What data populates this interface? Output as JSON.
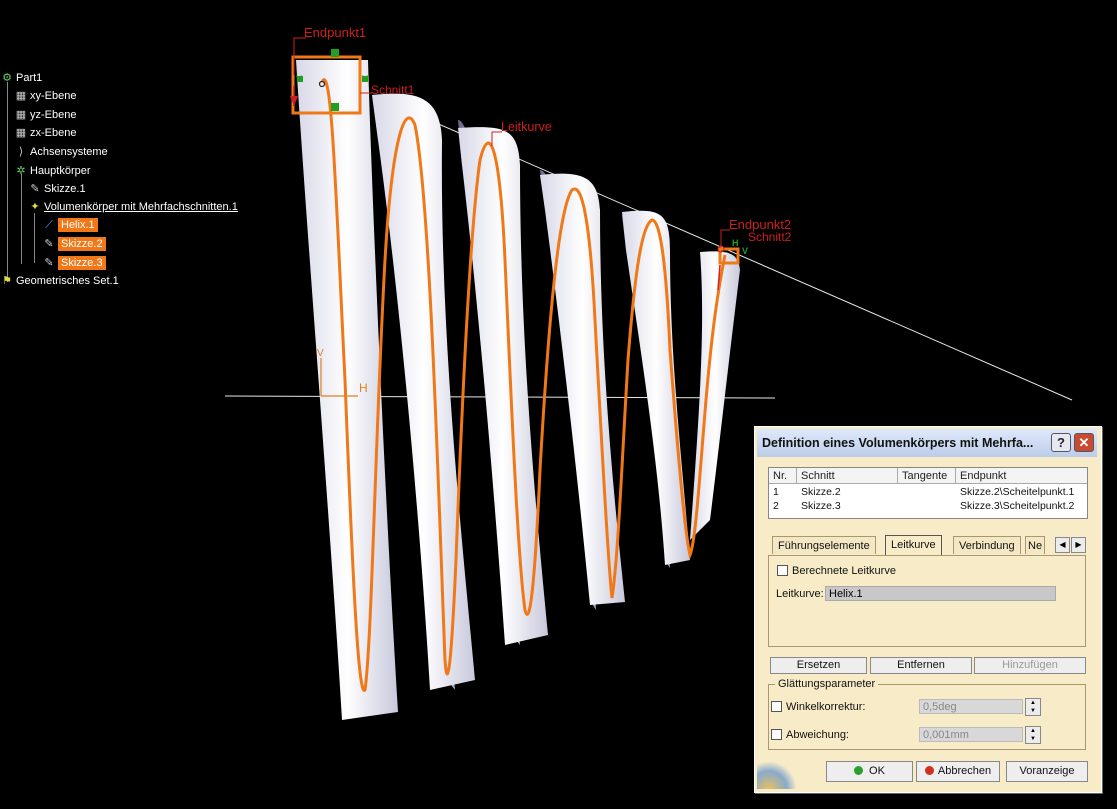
{
  "viewport": {
    "labels": {
      "endpoint1": "Endpunkt1",
      "section1": "Schnitt1",
      "guide_curve": "Leitkurve",
      "endpoint2": "Endpunkt2",
      "section2": "Schnitt2",
      "axis_h": "H",
      "axis_v": "V"
    },
    "colors": {
      "background": "#000000",
      "curve": "#f07818",
      "annotation": "#cc2020",
      "marker": "#20a020"
    }
  },
  "tree": {
    "items": [
      {
        "label": "Part1",
        "icon": "part-icon"
      },
      {
        "label": "xy-Ebene",
        "icon": "plane-icon"
      },
      {
        "label": "yz-Ebene",
        "icon": "plane-icon"
      },
      {
        "label": "zx-Ebene",
        "icon": "plane-icon"
      },
      {
        "label": "Achsensysteme",
        "icon": "axis-system-icon"
      },
      {
        "label": "Hauptkörper",
        "icon": "body-icon"
      },
      {
        "label": "Skizze.1",
        "icon": "sketch-icon"
      },
      {
        "label": "Volumenkörper mit Mehrfachschnitten.1",
        "icon": "multisection-solid-icon"
      },
      {
        "label": "Helix.1",
        "icon": "helix-icon"
      },
      {
        "label": "Skizze.2",
        "icon": "sketch-icon"
      },
      {
        "label": "Skizze.3",
        "icon": "sketch-icon"
      },
      {
        "label": "Geometrisches Set.1",
        "icon": "geometrical-set-icon"
      }
    ]
  },
  "dialog": {
    "title": "Definition eines Volumenkörpers mit Mehrfa...",
    "help": "?",
    "close": "✕",
    "table": {
      "headers": [
        "Nr.",
        "Schnitt",
        "Tangente",
        "Endpunkt"
      ],
      "rows": [
        [
          "1",
          "Skizze.2",
          "",
          "Skizze.2\\Scheitelpunkt.1"
        ],
        [
          "2",
          "Skizze.3",
          "",
          "Skizze.3\\Scheitelpunkt.2"
        ]
      ]
    },
    "tabs": [
      "Führungselemente",
      "Leitkurve",
      "Verbindung",
      "Ne"
    ],
    "active_tab": "Leitkurve",
    "computed_spine_label": "Berechnete Leitkurve",
    "spine_label": "Leitkurve:",
    "spine_value": "Helix.1",
    "replace": "Ersetzen",
    "remove": "Entfernen",
    "add": "Hinzufügen",
    "smoothing_group": "Glättungsparameter",
    "angle_label": "Winkelkorrektur:",
    "angle_value": "0,5deg",
    "deviation_label": "Abweichung:",
    "deviation_value": "0,001mm",
    "ok": "OK",
    "cancel": "Abbrechen",
    "preview": "Voranzeige"
  }
}
